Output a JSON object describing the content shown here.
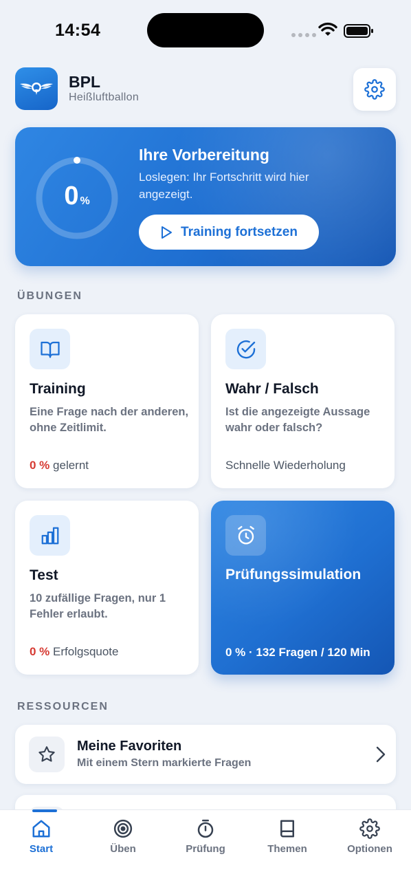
{
  "status_bar": {
    "time": "14:54"
  },
  "header": {
    "app_title": "BPL",
    "app_subtitle": "Heißluftballon"
  },
  "hero": {
    "progress_value": "0",
    "progress_unit": "%",
    "progress_fraction": 0,
    "title": "Ihre Vorbereitung",
    "text": "Loslegen: Ihr Fortschritt wird hier angezeigt.",
    "button_label": "Training fortsetzen"
  },
  "sections": {
    "exercises": "ÜBUNGEN",
    "resources": "RESSOURCEN"
  },
  "cards": {
    "training": {
      "title": "Training",
      "desc": "Eine Frage nach der anderen, ohne Zeitlimit.",
      "stat_value": "0 %",
      "stat_label": "gelernt"
    },
    "true_false": {
      "title": "Wahr / Falsch",
      "desc": "Ist die angezeigte Aussage wahr oder falsch?",
      "foot": "Schnelle Wiederholung"
    },
    "test": {
      "title": "Test",
      "desc": "10 zufällige Fragen, nur 1 Fehler erlaubt.",
      "stat_value": "0 %",
      "stat_label": "Erfolgsquote"
    },
    "exam_sim": {
      "title": "Prüfungssimulation",
      "foot": "0 % · 132 Fragen / 120 Min"
    }
  },
  "resources": {
    "favorites": {
      "title": "Meine Favoriten",
      "subtitle": "Mit einem Stern markierte Fragen"
    }
  },
  "tabbar": {
    "start": "Start",
    "practice": "Üben",
    "exam": "Prüfung",
    "topics": "Themen",
    "options": "Optionen"
  },
  "colors": {
    "accent": "#1d70d6",
    "danger": "#d63a32",
    "background": "#eef2f8"
  }
}
